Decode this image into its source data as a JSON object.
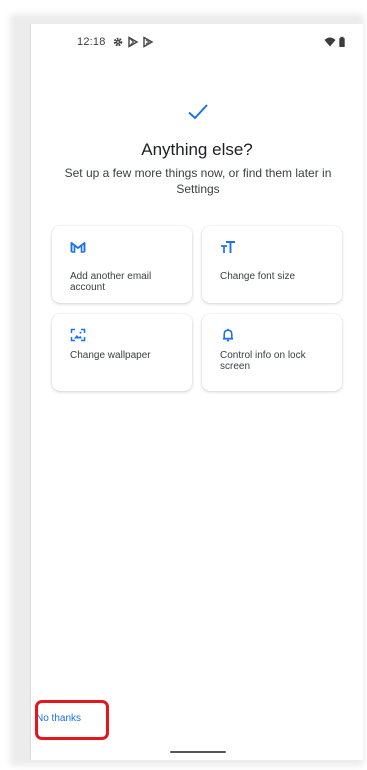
{
  "status_bar": {
    "time": "12:18",
    "icons": [
      "settings-icon",
      "play-store-icon",
      "play-protect-icon"
    ],
    "right_icons": [
      "wifi-icon",
      "battery-icon"
    ]
  },
  "header": {
    "check_icon": "check-icon",
    "title": "Anything else?",
    "subtitle": "Set up a few more things now, or find them later in Settings"
  },
  "cards": [
    {
      "icon": "gmail-icon",
      "label": "Add another email account"
    },
    {
      "icon": "font-size-icon",
      "label": "Change font size"
    },
    {
      "icon": "wallpaper-icon",
      "label": "Change wallpaper"
    },
    {
      "icon": "bell-icon",
      "label": "Control info on lock screen"
    }
  ],
  "footer": {
    "no_thanks_label": "No thanks"
  },
  "colors": {
    "accent": "#1a73e8",
    "highlight": "#e8141c"
  }
}
